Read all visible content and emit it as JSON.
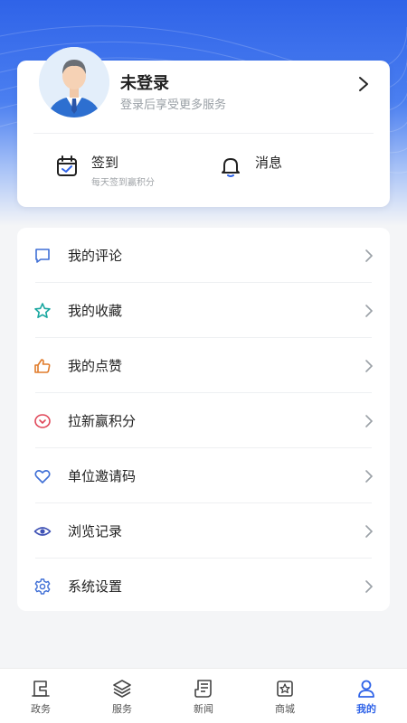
{
  "profile": {
    "name": "未登录",
    "subtitle": "登录后享受更多服务"
  },
  "quick_actions": {
    "checkin": {
      "title": "签到",
      "subtitle": "每天签到赢积分"
    },
    "messages": {
      "title": "消息"
    }
  },
  "menu": {
    "items": [
      {
        "label": "我的评论",
        "icon": "comment-icon",
        "color": "#3f6fd6"
      },
      {
        "label": "我的收藏",
        "icon": "star-icon",
        "color": "#1aa7a0"
      },
      {
        "label": "我的点赞",
        "icon": "thumbs-up-icon",
        "color": "#e07b2a"
      },
      {
        "label": "拉新赢积分",
        "icon": "reward-icon",
        "color": "#e0485a"
      },
      {
        "label": "单位邀请码",
        "icon": "heart-icon",
        "color": "#3f6fd6"
      },
      {
        "label": "浏览记录",
        "icon": "eye-icon",
        "color": "#3f52b5"
      },
      {
        "label": "系统设置",
        "icon": "settings-gear-icon",
        "color": "#3f6fd6"
      }
    ]
  },
  "tabbar": {
    "tabs": [
      {
        "label": "政务",
        "icon": "government-icon"
      },
      {
        "label": "服务",
        "icon": "layers-icon"
      },
      {
        "label": "新闻",
        "icon": "news-icon"
      },
      {
        "label": "商城",
        "icon": "store-icon"
      },
      {
        "label": "我的",
        "icon": "user-icon"
      }
    ],
    "active_color": "#2f63e8"
  },
  "colors": {
    "accent": "#2f63e8"
  }
}
